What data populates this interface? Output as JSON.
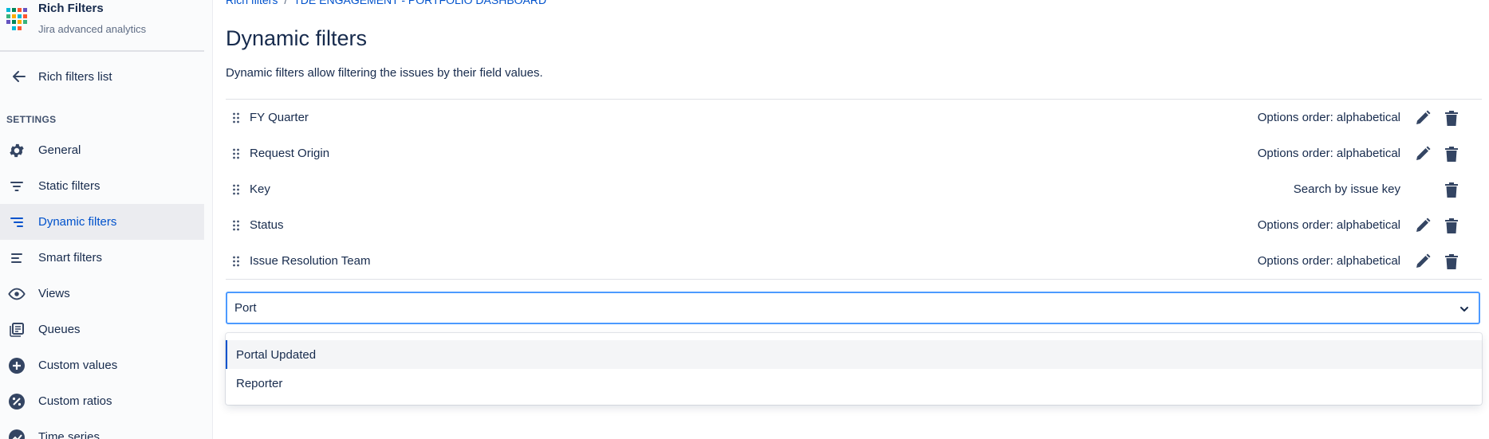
{
  "brand": {
    "title": "Rich Filters",
    "subtitle": "Jira advanced analytics"
  },
  "back": {
    "label": "Rich filters list"
  },
  "sidebar": {
    "section_label": "SETTINGS",
    "items": [
      {
        "label": "General",
        "icon": "gear-icon"
      },
      {
        "label": "Static filters",
        "icon": "static-filter-icon"
      },
      {
        "label": "Dynamic filters",
        "icon": "dynamic-filter-icon",
        "active": true
      },
      {
        "label": "Smart filters",
        "icon": "smart-filter-icon"
      },
      {
        "label": "Views",
        "icon": "eye-icon"
      },
      {
        "label": "Queues",
        "icon": "queue-icon"
      },
      {
        "label": "Custom values",
        "icon": "plus-circle-icon"
      },
      {
        "label": "Custom ratios",
        "icon": "percent-circle-icon"
      },
      {
        "label": "Time series",
        "icon": "trend-icon"
      }
    ]
  },
  "breadcrumb": {
    "first": "Rich filters",
    "separator": "/",
    "second": "TDE ENGAGEMENT - PORTFOLIO DASHBOARD"
  },
  "page": {
    "title": "Dynamic filters",
    "description": "Dynamic filters allow filtering the issues by their field values."
  },
  "filters": [
    {
      "name": "FY Quarter",
      "option": "Options order: alphabetical",
      "editable": true
    },
    {
      "name": "Request Origin",
      "option": "Options order: alphabetical",
      "editable": true
    },
    {
      "name": "Key",
      "option": "Search by issue key",
      "editable": false
    },
    {
      "name": "Status",
      "option": "Options order: alphabetical",
      "editable": true
    },
    {
      "name": "Issue Resolution Team",
      "option": "Options order: alphabetical",
      "editable": true
    }
  ],
  "select": {
    "value": "Port",
    "options": [
      "Portal Updated",
      "Reporter"
    ]
  },
  "colors": {
    "accent": "#0052cc",
    "icon": "#344563",
    "focus": "#4c9aff"
  }
}
